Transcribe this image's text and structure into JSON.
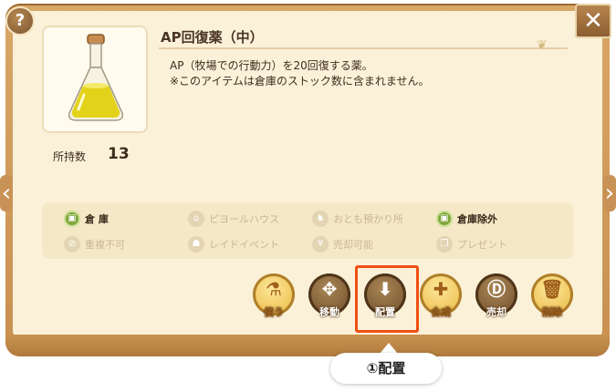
{
  "item": {
    "name": "AP回復薬（中）",
    "description_1": "AP（牧場での行動力）を20回復する薬。",
    "description_2": "※このアイテムは倉庫のストック数に含まれません。",
    "count_label": "所持数",
    "count": "13"
  },
  "controls": {
    "help": "?",
    "close": "✕",
    "prev": "‹",
    "next": "›"
  },
  "attributes": [
    {
      "label": "倉 庫",
      "active": true
    },
    {
      "label": "ピヨールハウス",
      "active": false
    },
    {
      "label": "おとも預かり所",
      "active": false
    },
    {
      "label": "倉庫除外",
      "active": true
    },
    {
      "label": "重複不可",
      "active": false
    },
    {
      "label": "レイドイベント",
      "active": false
    },
    {
      "label": "売却可能",
      "active": false
    },
    {
      "label": "プレゼント",
      "active": false
    }
  ],
  "actions": [
    {
      "label": "使う",
      "icon": "flask-icon",
      "enabled": true
    },
    {
      "label": "移動",
      "icon": "move-arrows-icon",
      "enabled": false
    },
    {
      "label": "配置",
      "icon": "place-down-icon",
      "enabled": false
    },
    {
      "label": "合成",
      "icon": "combine-icon",
      "enabled": true
    },
    {
      "label": "売却",
      "icon": "coin-icon",
      "enabled": false
    },
    {
      "label": "削除",
      "icon": "trash-icon",
      "enabled": true
    }
  ],
  "callout": {
    "text": "①配置"
  },
  "colors": {
    "frame": "#c8904f",
    "panel": "#fbf1d9",
    "highlight": "#f04f14",
    "active_attr": "#7ea53a"
  }
}
